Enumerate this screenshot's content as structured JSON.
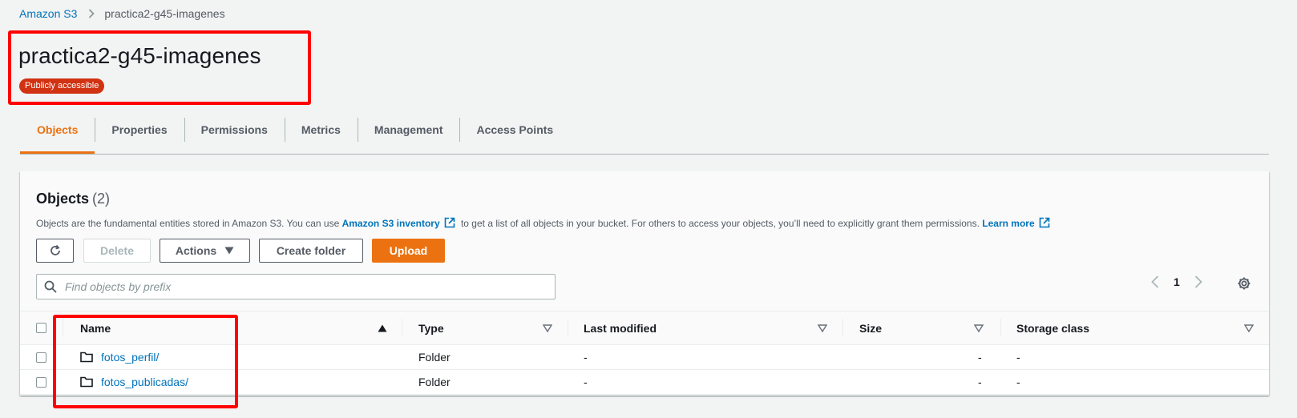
{
  "breadcrumb": {
    "root": "Amazon S3",
    "current": "practica2-g45-imagenes"
  },
  "header": {
    "title": "practica2-g45-imagenes",
    "badge": "Publicly accessible"
  },
  "tabs": [
    {
      "label": "Objects",
      "active": true
    },
    {
      "label": "Properties"
    },
    {
      "label": "Permissions"
    },
    {
      "label": "Metrics"
    },
    {
      "label": "Management"
    },
    {
      "label": "Access Points"
    }
  ],
  "objects": {
    "title": "Objects",
    "count": "(2)",
    "description": {
      "part1": "Objects are the fundamental entities stored in Amazon S3. You can use",
      "inventory_link": "Amazon S3 inventory",
      "part2": "to get a list of all objects in your bucket. For others to access your objects, you’ll need to explicitly grant them permissions.",
      "learn_more": "Learn more"
    },
    "buttons": {
      "refresh_icon": "refresh-icon",
      "delete": "Delete",
      "actions": "Actions",
      "create_folder": "Create folder",
      "upload": "Upload"
    },
    "search": {
      "placeholder": "Find objects by prefix",
      "value": ""
    },
    "pagination": {
      "page": "1"
    },
    "columns": [
      "Name",
      "Type",
      "Last modified",
      "Size",
      "Storage class"
    ],
    "rows": [
      {
        "name": "fotos_perfil/",
        "type": "Folder",
        "last_modified": "-",
        "size": "-",
        "storage_class": "-"
      },
      {
        "name": "fotos_publicadas/",
        "type": "Folder",
        "last_modified": "-",
        "size": "-",
        "storage_class": "-"
      }
    ]
  },
  "colors": {
    "accent": "#ec7211",
    "link": "#0073bb",
    "badge": "#d13212",
    "highlight": "#ff0000"
  }
}
